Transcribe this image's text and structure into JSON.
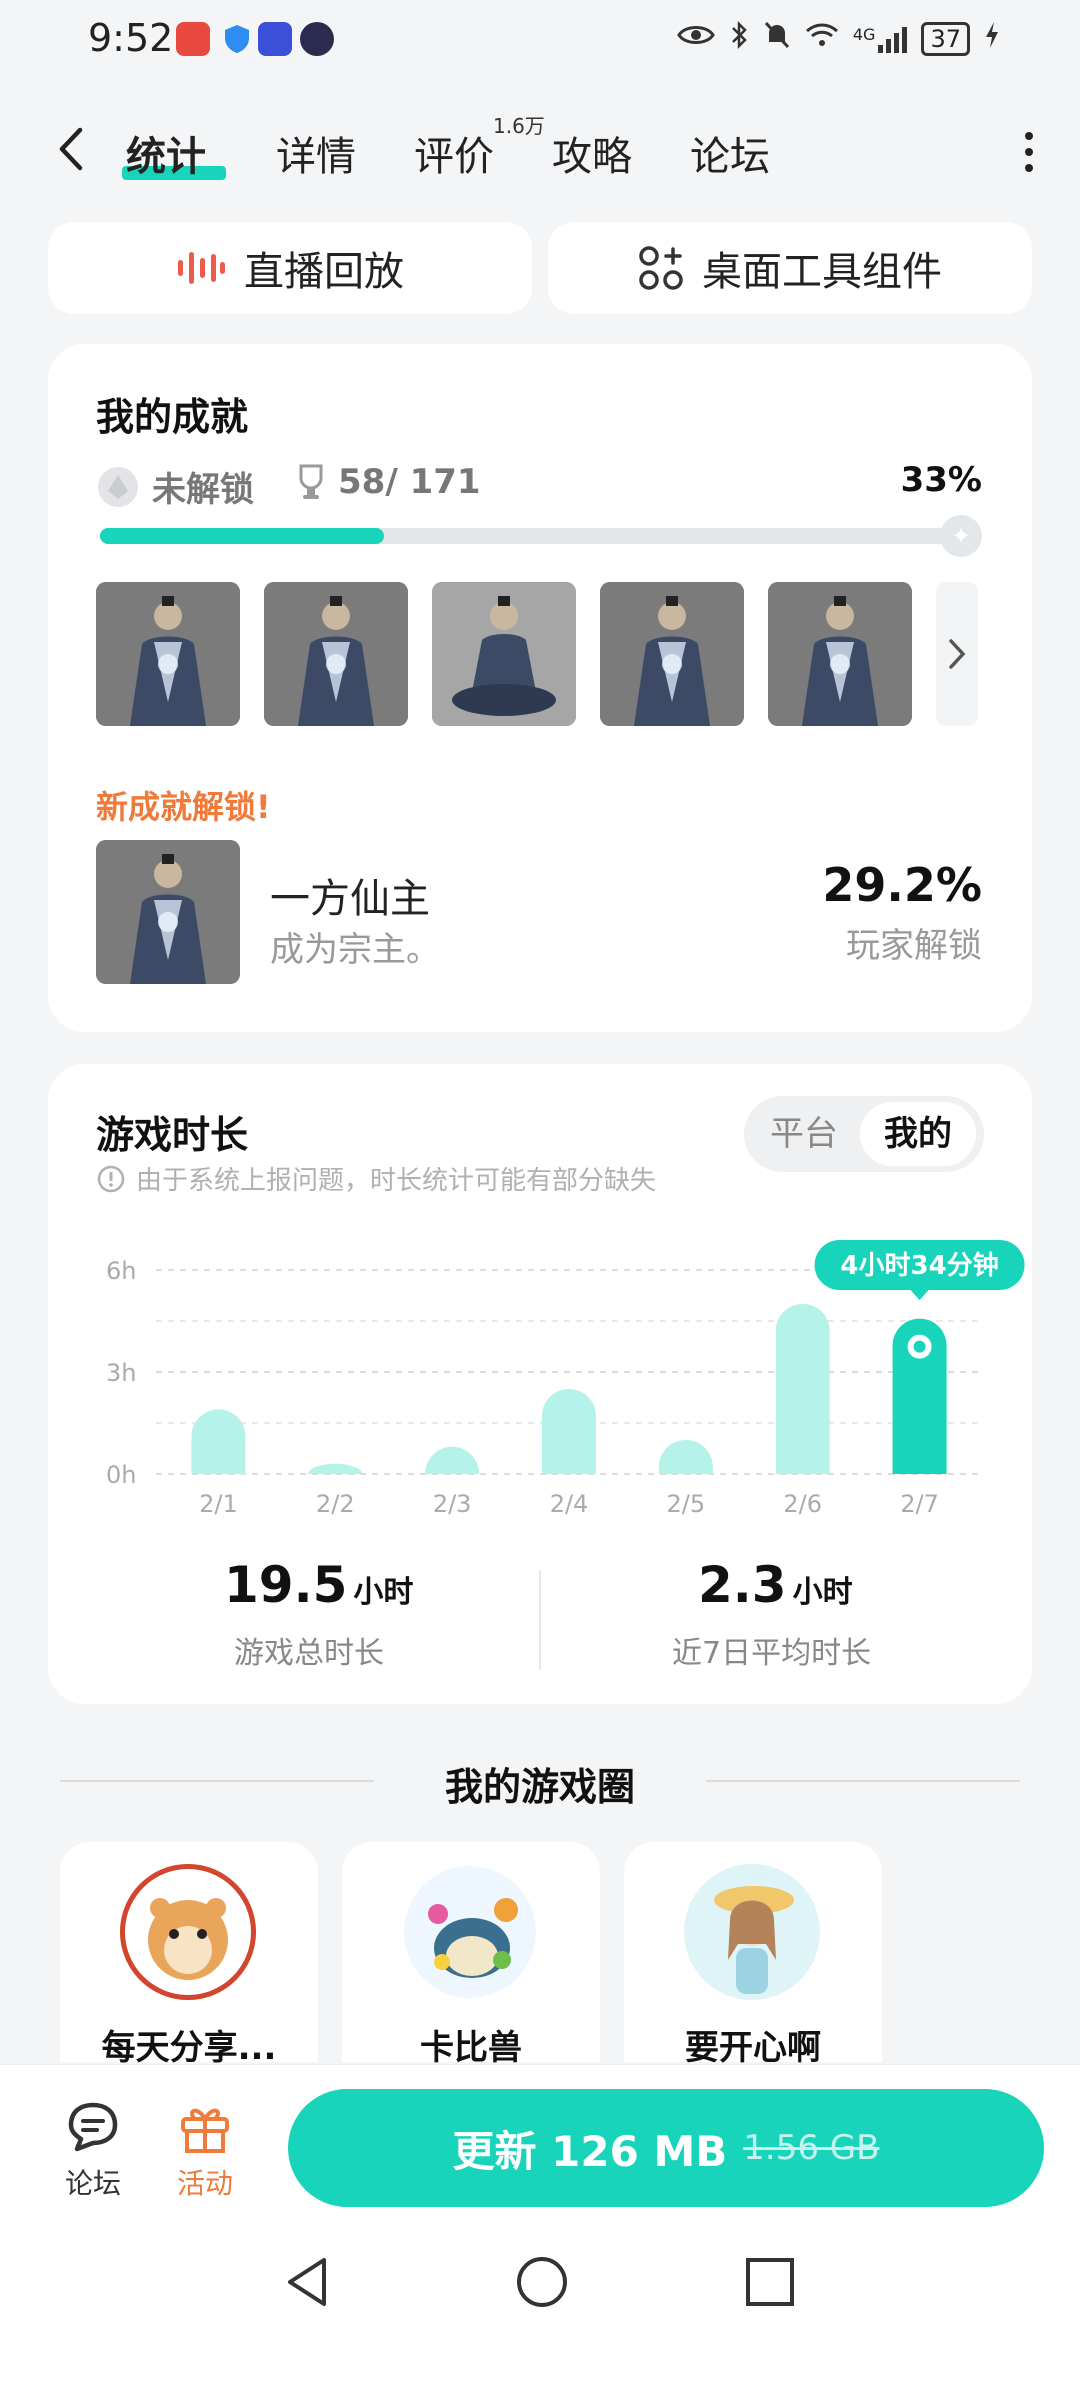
{
  "status": {
    "time": "9:52",
    "battery": "37",
    "signal": "4G"
  },
  "nav": {
    "tabs": [
      "统计",
      "详情",
      "评价",
      "攻略",
      "论坛"
    ],
    "review_count": "1.6万"
  },
  "top_buttons": {
    "replay": "直播回放",
    "widget": "桌面工具组件"
  },
  "achievements": {
    "title": "我的成就",
    "locked_label": "未解锁",
    "count": "58/ 171",
    "percent_text": "33%",
    "progress": 0.33,
    "new_unlock_label": "新成就解锁!",
    "new_name": "一方仙主",
    "new_desc": "成为宗主。",
    "new_rate": "29.2%",
    "new_rate_label": "玩家解锁"
  },
  "playtime": {
    "title": "游戏时长",
    "notice": "由于系统上报问题，时长统计可能有部分缺失",
    "seg_platform": "平台",
    "seg_mine": "我的",
    "tooltip": "4小时34分钟",
    "total_value": "19.5",
    "total_unit": "小时",
    "total_label": "游戏总时长",
    "avg_value": "2.3",
    "avg_unit": "小时",
    "avg_label": "近7日平均时长"
  },
  "chart_data": {
    "type": "bar",
    "categories": [
      "2/1",
      "2/2",
      "2/3",
      "2/4",
      "2/5",
      "2/6",
      "2/7"
    ],
    "values": [
      1.9,
      0.3,
      0.8,
      2.5,
      1.0,
      5.0,
      4.57
    ],
    "y_ticks": [
      "0h",
      "3h",
      "6h"
    ],
    "ylim": [
      0,
      6
    ],
    "highlight_index": 6,
    "colors": {
      "bar": "#b5f2ea",
      "highlight": "#17d4bb"
    }
  },
  "game_circle": {
    "title": "我的游戏圈",
    "items": [
      "每天分享...",
      "卡比兽",
      "要开心啊"
    ]
  },
  "bottom": {
    "forum": "论坛",
    "activity": "活动",
    "update_label": "更新 126 MB",
    "old_size": "1.56 GB"
  },
  "colors": {
    "accent": "#17d4bb",
    "orange": "#f07a3a"
  }
}
